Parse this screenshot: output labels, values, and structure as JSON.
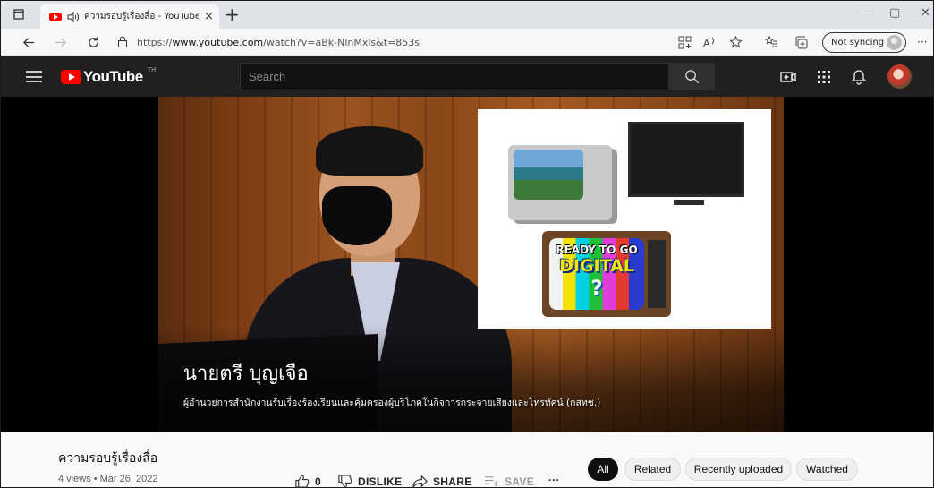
{
  "browser": {
    "tab_title": "ความรอบรู้เรื่องสื่อ - YouTube",
    "tab_close": "×",
    "new_tab": "+",
    "minimize": "—",
    "restore": "▢",
    "close": "✕",
    "url_prefix": "https://",
    "url_host": "www.youtube.com",
    "url_path": "/watch?v=aBk-NlnMxls&t=853s",
    "sync_label": "Not syncing",
    "more_label": "···"
  },
  "youtube": {
    "logo_text": "YouTube",
    "country_code": "TH",
    "search_placeholder": "Search"
  },
  "video": {
    "inset_ready": "READY TO GO",
    "inset_digital": "DIGITAL",
    "inset_qmark": "?",
    "caption_name": "นายตรี บุญเจือ",
    "caption_role": "ผู้อำนวยการสำนักงานรับเรื่องร้องเรียนและคุ้มครองผู้บริโภคในกิจการกระจายเสียงและโทรทัศน์ (กสทช.)"
  },
  "details": {
    "title": "ความรอบรู้เรื่องสื่อ",
    "meta": "4 views • Mar 26, 2022",
    "like_count": "0",
    "dislike_label": "DISLIKE",
    "share_label": "SHARE",
    "save_label": "SAVE",
    "more_label": "···"
  },
  "chips": [
    "All",
    "Related",
    "Recently uploaded",
    "Watched"
  ],
  "colors": {
    "youtube_red": "#ff0000",
    "header_bg": "#202020",
    "chip_active_bg": "#0f0f0f"
  },
  "icons": [
    "tab-actions-icon",
    "youtube-favicon",
    "speaker-icon",
    "back-icon",
    "forward-icon",
    "refresh-icon",
    "lock-icon",
    "apps-icon",
    "read-aloud-icon",
    "favorite-icon",
    "favorites-bar-icon",
    "collections-icon",
    "profile-icon",
    "hamburger-icon",
    "search-icon",
    "create-icon",
    "apps-grid-icon",
    "bell-icon",
    "like-icon",
    "dislike-icon",
    "share-icon",
    "save-icon"
  ]
}
